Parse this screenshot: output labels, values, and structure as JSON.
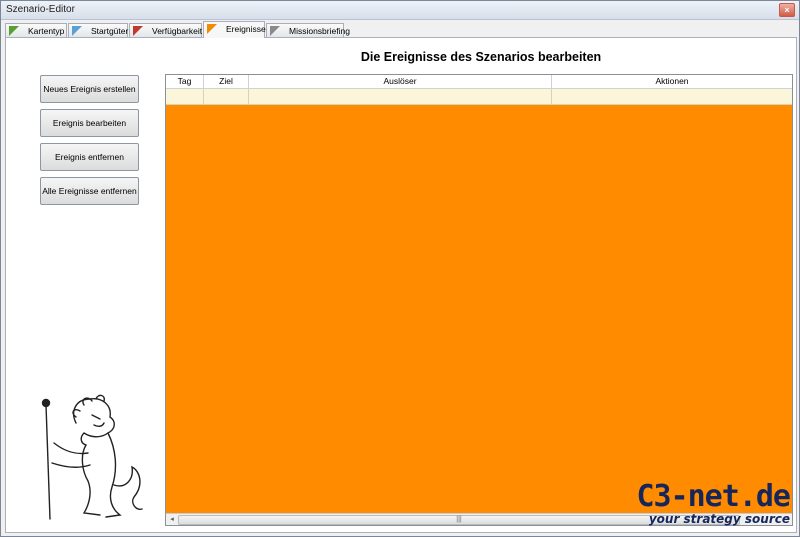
{
  "window": {
    "title": "Szenario-Editor",
    "close_symbol": "×"
  },
  "tabs": [
    {
      "label": "Kartentyp",
      "flag_color": "#5aa02c"
    },
    {
      "label": "Startgüter",
      "flag_color": "#5aa0d8"
    },
    {
      "label": "Verfügbarkeit",
      "flag_color": "#c0392b"
    },
    {
      "label": "Ereignisse",
      "flag_color": "#f08c00",
      "active": true
    },
    {
      "label": "Missionsbriefing",
      "flag_color": "#8a8a8a"
    }
  ],
  "page": {
    "heading": "Die Ereignisse des Szenarios bearbeiten"
  },
  "actions": {
    "new_event": "Neues Ereignis erstellen",
    "edit_event": "Ereignis bearbeiten",
    "remove_event": "Ereignis entfernen",
    "remove_all_events": "Alle Ereignisse entfernen"
  },
  "table": {
    "columns": [
      "Tag",
      "Ziel",
      "Auslöser",
      "Aktionen"
    ],
    "rows": [
      [
        "",
        "",
        "",
        ""
      ]
    ],
    "background_color": "#ff8c00"
  },
  "scrollbar": {
    "left_arrow": "◂",
    "grip": "|||"
  },
  "watermark": {
    "name": "C3-net.de",
    "tagline": "your strategy source"
  }
}
